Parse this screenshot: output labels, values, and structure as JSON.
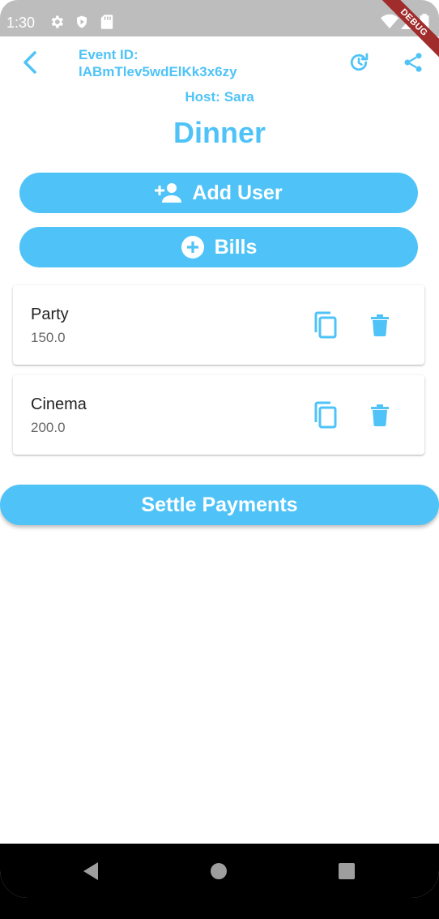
{
  "status_bar": {
    "time": "1:30",
    "icons": [
      "gear-icon",
      "shield-icon",
      "sd-card-icon",
      "wifi-icon",
      "signal-icon",
      "battery-icon"
    ],
    "debug_label": "DEBUG"
  },
  "header": {
    "event_id_label": "Event ID:",
    "event_id_value": "lABmTlev5wdElKk3x6zy",
    "host_prefix": "Host:",
    "host_name": "Sara",
    "title": "Dinner"
  },
  "actions": {
    "add_user_label": "Add User",
    "bills_label": "Bills",
    "settle_label": "Settle Payments"
  },
  "bills": [
    {
      "name": "Party",
      "amount": "150.0"
    },
    {
      "name": "Cinema",
      "amount": "200.0"
    }
  ],
  "colors": {
    "accent": "#4fc3f7",
    "status_bar": "#bdbdbd",
    "debug_banner": "#a12c2c"
  }
}
